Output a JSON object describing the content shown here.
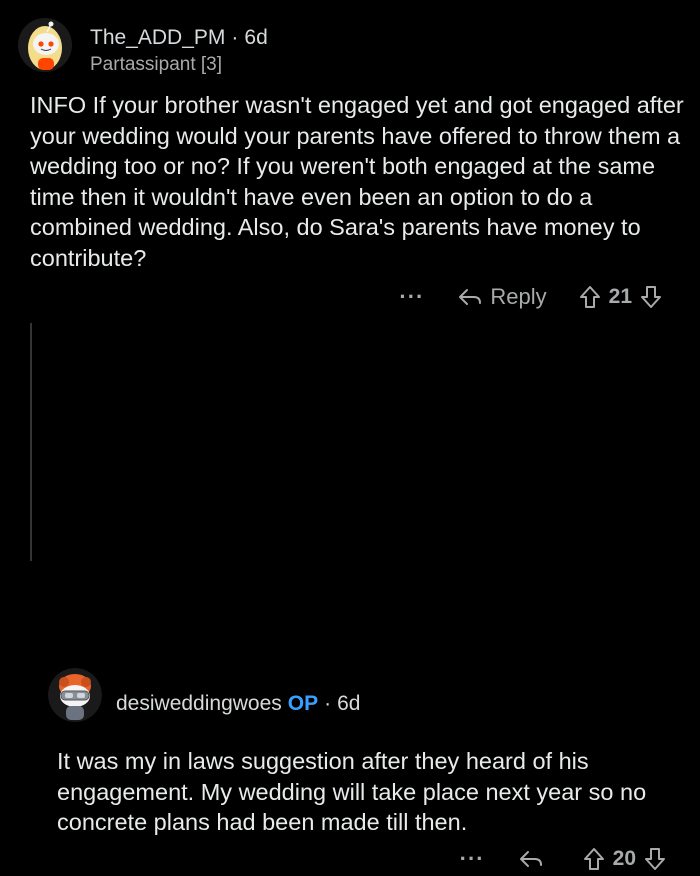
{
  "comment1": {
    "username": "The_ADD_PM",
    "separator": "·",
    "age": "6d",
    "flair": "Partassipant [3]",
    "body": "INFO If your brother wasn't engaged yet and got engaged after your wedding would your parents have offered to throw  them a wedding too or no? If you weren't both engaged at the same time then it wouldn't have even been an option to do a combined wedding. Also, do Sara's parents have money to contribute?",
    "more_label": "···",
    "reply_label": "Reply",
    "score": "21"
  },
  "comment2": {
    "username": "desiweddingwoes",
    "op_badge": "OP",
    "separator": "·",
    "age": "6d",
    "body": "It was my in laws suggestion after they heard of his engagement. My wedding will take place next year so no concrete plans had been made till then.",
    "more_label": "···",
    "score": "20"
  },
  "icons": {
    "reply": "reply-arrow-icon",
    "upvote": "upvote-arrow-icon",
    "downvote": "downvote-arrow-icon",
    "avatar1": "snoo-avatar-blonde",
    "avatar2": "snoo-avatar-orange-hair-goggles"
  },
  "colors": {
    "background": "#000000",
    "text": "#d7dadc",
    "muted": "#a8aaab",
    "op_badge": "#3aa0ff",
    "thread_line": "#343536"
  }
}
